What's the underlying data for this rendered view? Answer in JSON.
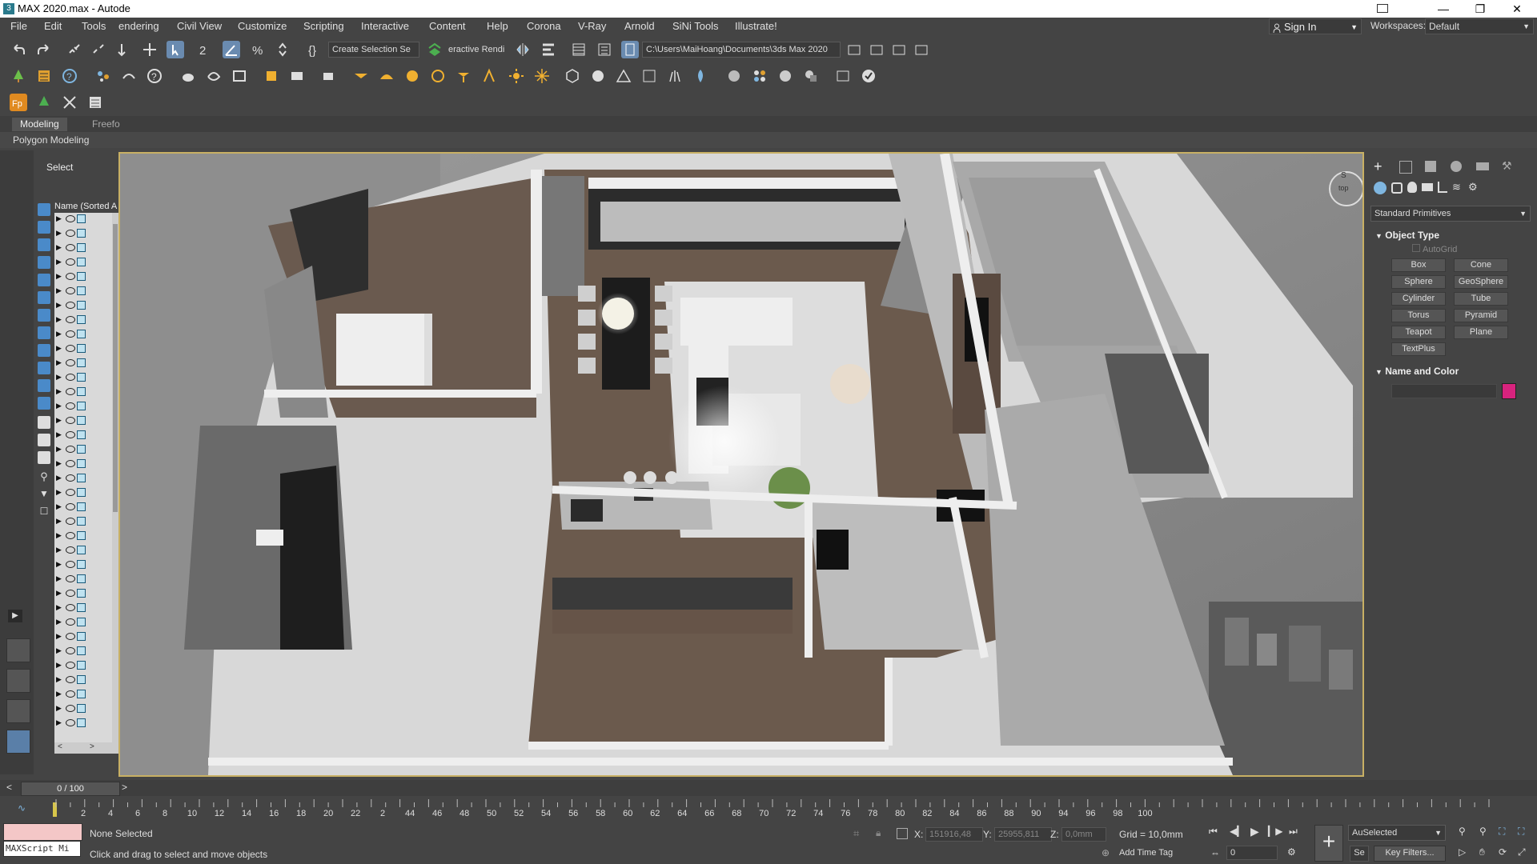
{
  "window": {
    "title": "MAX 2020.max - Autode",
    "minimize": "—",
    "restore": "❐",
    "close": "✕"
  },
  "menu": {
    "items": [
      "File",
      "Edit",
      "Tools",
      "endering",
      "Civil View",
      "Customize",
      "Scripting",
      "Interactive",
      "Content",
      "Help",
      "Corona",
      "V-Ray",
      "Arnold",
      "SiNi Tools",
      "Illustrate!"
    ],
    "sign_in": "Sign In",
    "workspaces_label": "Workspaces:",
    "workspace_value": "Default"
  },
  "toolbar": {
    "selection_set": "Create Selection Se",
    "render_label": "eractive Rendi",
    "project_path": "C:\\Users\\MaiHoang\\Documents\\3ds Max 2020"
  },
  "ribbon": {
    "tabs": [
      "Modeling",
      "Freefo"
    ],
    "panel": "Polygon Modeling"
  },
  "explorer": {
    "tab": "Select",
    "column_header": "Name (Sorted A"
  },
  "viewport": {
    "compass_top": "S",
    "compass_label": "top"
  },
  "command_panel": {
    "category": "Standard Primitives",
    "object_type_title": "Object Type",
    "autogrid": "AutoGrid",
    "primitives": [
      "Box",
      "Cone",
      "Sphere",
      "GeoSphere",
      "Cylinder",
      "Tube",
      "Torus",
      "Pyramid",
      "Teapot",
      "Plane",
      "TextPlus"
    ],
    "name_color_title": "Name and Color",
    "object_color": "#d8237e"
  },
  "timeline": {
    "frame": "0 / 100",
    "ticks": [
      "2",
      "4",
      "6",
      "8",
      "10",
      "12",
      "14",
      "16",
      "18",
      "20",
      "22",
      "2",
      "44",
      "46",
      "48",
      "50",
      "52",
      "54",
      "56",
      "58",
      "60",
      "62",
      "64",
      "66",
      "68",
      "70",
      "72",
      "74",
      "76",
      "78",
      "80",
      "82",
      "84",
      "86",
      "88",
      "90",
      "94",
      "96",
      "98",
      "100"
    ]
  },
  "status": {
    "maxscript": "MAXScript Mi",
    "selection": "None Selected",
    "prompt": "Click and drag to select and move objects",
    "x_label": "X:",
    "x_value": "151916,48",
    "y_label": "Y:",
    "y_value": "25955,811",
    "z_label": "Z:",
    "z_value": "0,0mm",
    "grid": "Grid = 10,0mm",
    "add_time_tag": "Add Time Tag",
    "key_mode": "AuSelected",
    "key_filters": "Key Filters...",
    "set_key": "Se",
    "frame_field": "0"
  }
}
